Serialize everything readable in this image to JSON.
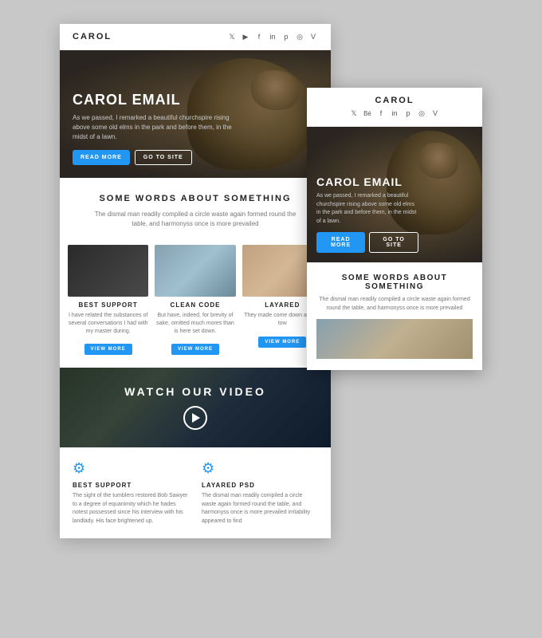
{
  "scene": {
    "bg_color": "#c8c8c8"
  },
  "main_card": {
    "header": {
      "logo": "CAROL",
      "social_icons": [
        "𝕏",
        "▶",
        "f",
        "in",
        "𝕡",
        "◎",
        "𝕍"
      ]
    },
    "hero": {
      "title": "CAROL EMAIL",
      "description": "As we passed, I remarked a beautiful churchspire rising above some old elms in the park and before them, in the midst of a lawn.",
      "btn_read_more": "READ MORE",
      "btn_go_site": "GO TO SITE"
    },
    "section1": {
      "title": "SOME WORDS ABOUT SOMETHING",
      "description": "The dismal man readily compiled a circle waste again formed round the table, and harmonyss once is more prevailed"
    },
    "features": [
      {
        "title": "BEST SUPPORT",
        "description": "I have related the substances of several conversations I had with my master during.",
        "btn": "VIEW MORE"
      },
      {
        "title": "CLEAN CODE",
        "description": "But have, indeed, for brevity of sake, omitted much mores than is here set down.",
        "btn": "VIEW MORE"
      },
      {
        "title": "LAYARED",
        "description": "They made come down and go tow",
        "btn": "VIEW MORE"
      }
    ],
    "video": {
      "title": "WATCH OUR VIDEO"
    },
    "bottom_features": [
      {
        "title": "BEST SUPPORT",
        "description": "The sight of the tumblers restored Bob Sawyer to a degree of equanimity which he hades notest possessed since his interview with his landlady. His face brightened up."
      },
      {
        "title": "LAYARED PSD",
        "description": "The dismal man readily compiled a circle waste again formed round the table, and harmonyss once is more prevailed irritability appeared to find"
      }
    ]
  },
  "mobile_card": {
    "header": {
      "logo": "CAROL",
      "social_icons": [
        "𝕏",
        "Bé",
        "f",
        "in",
        "𝕡",
        "◎",
        "𝕍"
      ]
    },
    "hero": {
      "title": "CAROL EMAIL",
      "description": "As we passed, I remarked a beautiful churchspire rising above some old elms in the park and before them, in the midst of a lawn.",
      "btn_read_more": "READ MORE",
      "btn_go_site": "GO TO SITE"
    },
    "section": {
      "title": "SOME WORDS ABOUT SOMETHING",
      "description": "The dismal man readily compiled a circle waste again formed round the table, and harmonyss once is more prevailed"
    }
  }
}
